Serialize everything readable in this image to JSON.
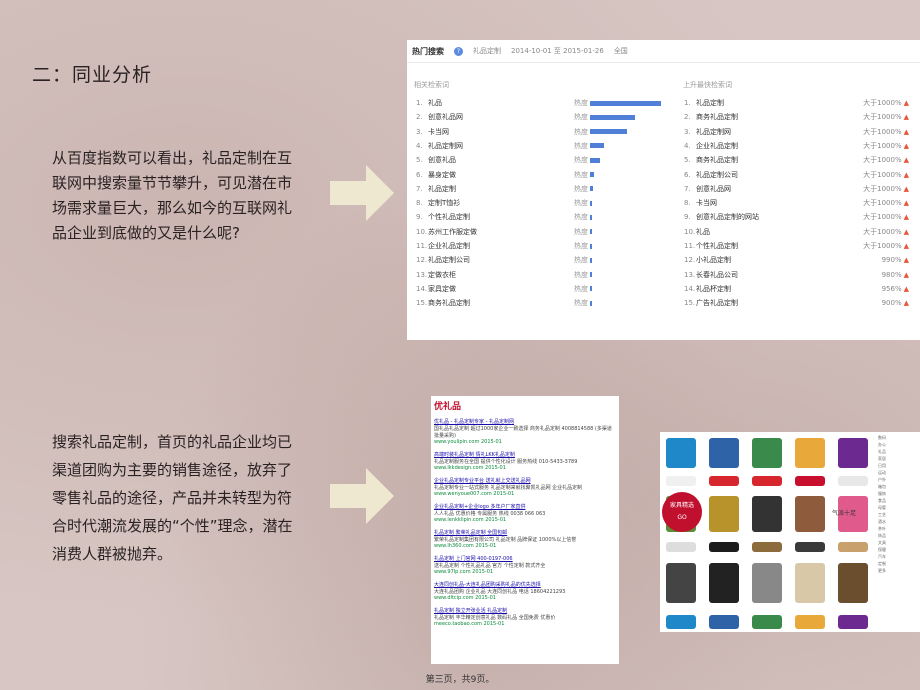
{
  "heading": "二：同业分析",
  "para1": "从百度指数可以看出，礼品定制在互联网中搜索量节节攀升，可见潜在市场需求量巨大，那么如今的互联网礼品企业到底做的又是什么呢?",
  "para2": "搜索礼品定制，首页的礼品企业均已渠道团购为主要的销售途径，放弃了零售礼品的途径，产品并未转型为符合时代潮流发展的“个性”理念，潜在消费人群被抛弃。",
  "footer": "第三页，共9页。",
  "panel": {
    "title": "热门搜索",
    "keyword": "礼品定制",
    "range": "2014-10-01 至 2015-01-26",
    "region": "全国",
    "left_title": "相关检索词",
    "right_title": "上升最快检索词",
    "hot_label": "热度",
    "left": [
      {
        "n": "1.",
        "k": "礼品",
        "v": 0.98
      },
      {
        "n": "2.",
        "k": "创意礼品网",
        "v": 0.62
      },
      {
        "n": "3.",
        "k": "卡当网",
        "v": 0.52
      },
      {
        "n": "4.",
        "k": "礼品定制网",
        "v": 0.2
      },
      {
        "n": "5.",
        "k": "创意礼品",
        "v": 0.14
      },
      {
        "n": "6.",
        "k": "暴身定做",
        "v": 0.05
      },
      {
        "n": "7.",
        "k": "礼品定制",
        "v": 0.04
      },
      {
        "n": "8.",
        "k": "定制T恤衫",
        "v": 0.03
      },
      {
        "n": "9.",
        "k": "个性礼品定制",
        "v": 0.02
      },
      {
        "n": "10.",
        "k": "苏州工作服定做",
        "v": 0.02
      },
      {
        "n": "11.",
        "k": "企业礼品定制",
        "v": 0.02
      },
      {
        "n": "12.",
        "k": "礼品定制公司",
        "v": 0.01
      },
      {
        "n": "13.",
        "k": "定做衣柜",
        "v": 0.01
      },
      {
        "n": "14.",
        "k": "家具定做",
        "v": 0.01
      },
      {
        "n": "15.",
        "k": "商务礼品定制",
        "v": 0.01
      }
    ],
    "right": [
      {
        "n": "1.",
        "k": "礼品定制",
        "v": "大于1000%"
      },
      {
        "n": "2.",
        "k": "商务礼品定制",
        "v": "大于1000%"
      },
      {
        "n": "3.",
        "k": "礼品定制网",
        "v": "大于1000%"
      },
      {
        "n": "4.",
        "k": "企业礼品定制",
        "v": "大于1000%"
      },
      {
        "n": "5.",
        "k": "商务礼品定制",
        "v": "大于1000%"
      },
      {
        "n": "6.",
        "k": "礼品定制公司",
        "v": "大于1000%"
      },
      {
        "n": "7.",
        "k": "创意礼品网",
        "v": "大于1000%"
      },
      {
        "n": "8.",
        "k": "卡当网",
        "v": "大于1000%"
      },
      {
        "n": "9.",
        "k": "创意礼品定制的网站",
        "v": "大于1000%"
      },
      {
        "n": "10.",
        "k": "礼品",
        "v": "大于1000%"
      },
      {
        "n": "11.",
        "k": "个性礼品定制",
        "v": "大于1000%"
      },
      {
        "n": "12.",
        "k": "小礼品定制",
        "v": "990%"
      },
      {
        "n": "13.",
        "k": "长春礼品公司",
        "v": "980%"
      },
      {
        "n": "14.",
        "k": "礼品杯定制",
        "v": "956%"
      },
      {
        "n": "15.",
        "k": "广告礼品定制",
        "v": "900%"
      }
    ]
  },
  "search": {
    "logo": "优礼品",
    "results": [
      {
        "t": "优礼品 - 礼品定制专家 - 礼品定制网",
        "d": "国礼品礼品定制 超过1000家企业一致选择 商务礼品定制 4008814588 (多渠道批量采购)",
        "u": "www.youlipin.com 2015-01"
      },
      {
        "t": "高端时装礼品定制 情礼LKK礼品定制",
        "d": "礼品定制服务在全国 提供个性化设计 服务热线 010-5433-3789",
        "u": "www.lkkdesign.com 2015-01"
      },
      {
        "t": "企业礼品定制专业平台 送礼就上交送礼品网",
        "d": "礼品定制专业一站式服务 礼品定制来就找聚凯礼品网 企业礼品定制",
        "u": "www.wenyoue007.com 2015-01"
      },
      {
        "t": "企业礼品定制+企业logo 多年户厂家直供",
        "d": "人人礼品 优惠价格 专属服务 热线 0038 066 063",
        "u": "www.lenkklipin.com 2015-01"
      },
      {
        "t": "礼品定制 繁荣礼品定制 全国包邮",
        "d": "繁荣礼品定制集团有限公司 礼品定制 品牌保证 1000%以上信誉",
        "u": "www.lh360.com 2015-01"
      },
      {
        "t": "礼品定制 上门官网 400-0197-006",
        "d": "送礼品定制 个性礼品礼品 官方 个性定制 款式齐全",
        "u": "www.97lp.com 2015-01"
      },
      {
        "t": "大连同创礼品-大连礼品团购采购礼品的优先选择",
        "d": "大连礼品团购 企业礼品 大连同创礼品 电话 18604221293",
        "u": "www.dltcip.com 2015-01"
      },
      {
        "t": "礼品定制 独立开张业活 礼品定制",
        "d": "礼品定制 丰华精定创意礼品 数码礼品 全国免费 优惠价",
        "u": "meeco.taobao.com 2015-01"
      }
    ]
  },
  "shop": {
    "banner1": "家具精选",
    "banner2": "GO",
    "banner3": "气派十足",
    "side": [
      "数码",
      "办公",
      "礼品",
      "家居",
      "日用",
      "运动",
      "户外",
      "箱包",
      "服饰",
      "食品",
      "母婴",
      "工艺",
      "酒水",
      "茶叶",
      "饰品",
      "文具",
      "保健",
      "汽车",
      "定制",
      "更多"
    ]
  },
  "colors": {
    "accent": "#4f7fd6",
    "red": "#c0102e",
    "up": "#e8563b",
    "bg": "#d7c6c3"
  }
}
